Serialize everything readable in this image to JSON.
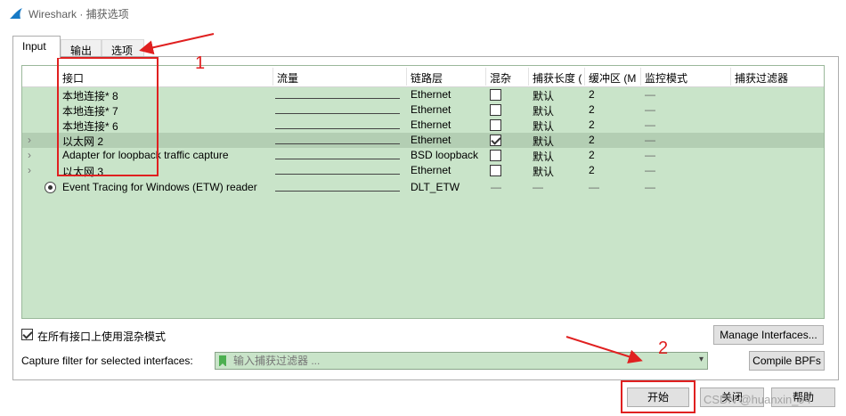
{
  "window": {
    "title": "Wireshark · 捕获选项"
  },
  "tabs": [
    {
      "label": "Input"
    },
    {
      "label": "输出"
    },
    {
      "label": "选项"
    }
  ],
  "table": {
    "headers": [
      "接口",
      "流量",
      "链路层",
      "混杂",
      "捕获长度 (",
      "缓冲区 (M",
      "监控模式",
      "捕获过滤器"
    ],
    "rows": [
      {
        "name": "本地连接* 8",
        "link": "Ethernet",
        "promisc": false,
        "snaplen": "默认",
        "buffer": "2",
        "monitor": "—",
        "expandable": false,
        "selected": false
      },
      {
        "name": "本地连接* 7",
        "link": "Ethernet",
        "promisc": false,
        "snaplen": "默认",
        "buffer": "2",
        "monitor": "—",
        "expandable": false,
        "selected": false
      },
      {
        "name": "本地连接* 6",
        "link": "Ethernet",
        "promisc": false,
        "snaplen": "默认",
        "buffer": "2",
        "monitor": "—",
        "expandable": false,
        "selected": false
      },
      {
        "name": "以太网 2",
        "link": "Ethernet",
        "promisc": true,
        "snaplen": "默认",
        "buffer": "2",
        "monitor": "—",
        "expandable": true,
        "selected": true
      },
      {
        "name": "Adapter for loopback traffic capture",
        "link": "BSD loopback",
        "promisc": false,
        "snaplen": "默认",
        "buffer": "2",
        "monitor": "—",
        "expandable": true,
        "selected": false
      },
      {
        "name": "以太网 3",
        "link": "Ethernet",
        "promisc": false,
        "snaplen": "默认",
        "buffer": "2",
        "monitor": "—",
        "expandable": true,
        "selected": false
      },
      {
        "name": "Event Tracing for Windows (ETW) reader",
        "link": "DLT_ETW",
        "promisc_text": "—",
        "snaplen": "—",
        "buffer": "—",
        "monitor": "—",
        "expandable": false,
        "selected": false
      }
    ]
  },
  "promisc_all": {
    "label": "在所有接口上使用混杂模式",
    "checked": true
  },
  "manage_interfaces": {
    "label": "Manage Interfaces..."
  },
  "capture_filter": {
    "label": "Capture filter for selected interfaces:",
    "placeholder": "输入捕获过滤器 ..."
  },
  "compile_bpfs": {
    "label": "Compile BPFs"
  },
  "buttons": {
    "start": "开始",
    "close": "关闭",
    "help": "帮助"
  },
  "annotations": {
    "one": "1",
    "two": "2"
  },
  "watermark": "CSDN @huanxin_94",
  "colors": {
    "grid_bg": "#c9e4c9",
    "selected_row": "#b3ceb3",
    "annotation": "#e02020"
  }
}
